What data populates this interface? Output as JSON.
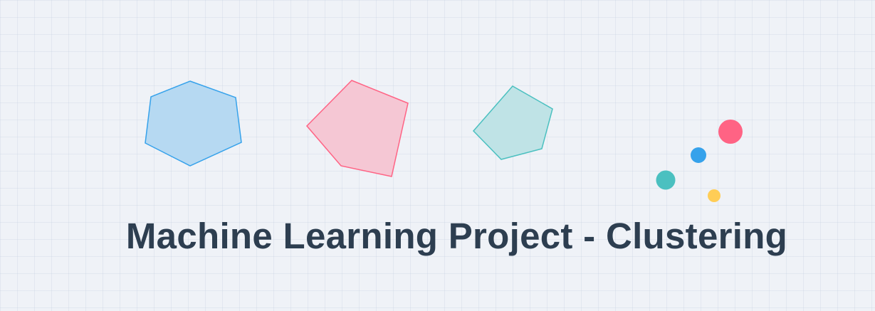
{
  "title": "Machine Learning Project - Clustering",
  "colors": {
    "background": "#eff2f7",
    "title": "#2d3e50",
    "blue": "#36a2eb",
    "pink": "#ff6384",
    "teal": "#4bc0c0",
    "yellow": "#ffcd56"
  },
  "shapes": [
    {
      "name": "hexagon",
      "kind": "hexagon",
      "color": "blue"
    },
    {
      "name": "pentagon-large",
      "kind": "pentagon",
      "color": "pink"
    },
    {
      "name": "pentagon-small",
      "kind": "pentagon",
      "color": "teal"
    }
  ],
  "points": [
    {
      "name": "point-pink",
      "color": "pink"
    },
    {
      "name": "point-blue",
      "color": "blue"
    },
    {
      "name": "point-teal",
      "color": "teal"
    },
    {
      "name": "point-yellow",
      "color": "yellow"
    }
  ]
}
